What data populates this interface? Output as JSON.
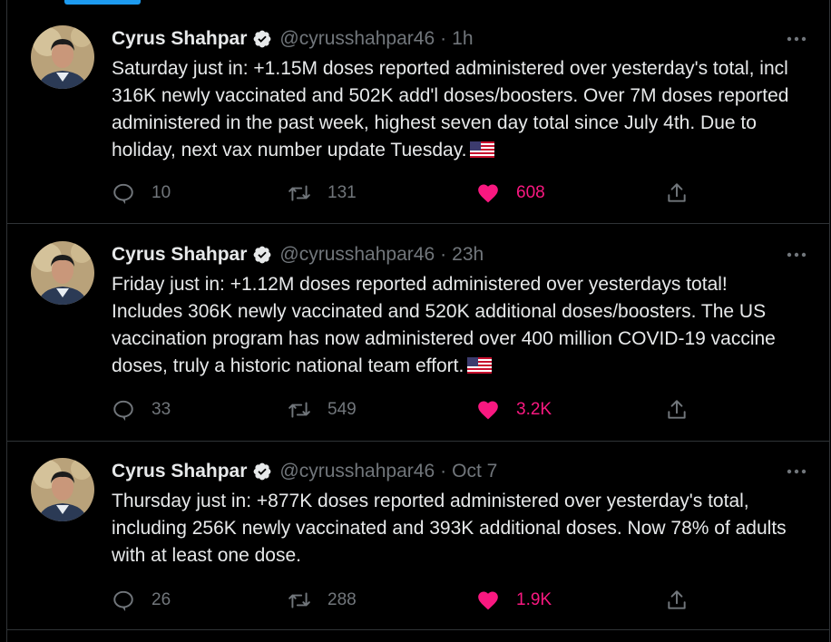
{
  "colors": {
    "background": "#000000",
    "text": "#e7e9ea",
    "muted": "#71767b",
    "accent": "#1d9bf0",
    "like": "#f91880",
    "divider": "#2f3336"
  },
  "icons": {
    "reply": "reply-icon",
    "retweet": "retweet-icon",
    "like": "heart-icon",
    "share": "share-icon",
    "more": "more-icon",
    "verified": "verified-badge-icon"
  },
  "tweets": [
    {
      "name": "Cyrus Shahpar",
      "handle": "@cyrusshahpar46",
      "separator": "·",
      "time": "1h",
      "text": "Saturday just in: +1.15M doses reported administered over yesterday's total, incl 316K newly vaccinated and 502K add'l doses/boosters. Over 7M doses reported administered in the past week, highest seven day total since July 4th. Due to holiday, next vax number update Tuesday.",
      "has_flag": true,
      "replies": "10",
      "retweets": "131",
      "likes": "608"
    },
    {
      "name": "Cyrus Shahpar",
      "handle": "@cyrusshahpar46",
      "separator": "·",
      "time": "23h",
      "text": "Friday just in: +1.12M doses reported administered over yesterdays total! Includes 306K newly vaccinated and 520K additional doses/boosters. The US vaccination program has now administered over 400 million COVID-19 vaccine doses, truly a historic national team effort.",
      "has_flag": true,
      "replies": "33",
      "retweets": "549",
      "likes": "3.2K"
    },
    {
      "name": "Cyrus Shahpar",
      "handle": "@cyrusshahpar46",
      "separator": "·",
      "time": "Oct 7",
      "text": "Thursday just in: +877K doses reported administered over yesterday's total, including 256K newly vaccinated and 393K additional doses. Now 78% of adults with at least one dose.",
      "has_flag": false,
      "replies": "26",
      "retweets": "288",
      "likes": "1.9K"
    }
  ]
}
